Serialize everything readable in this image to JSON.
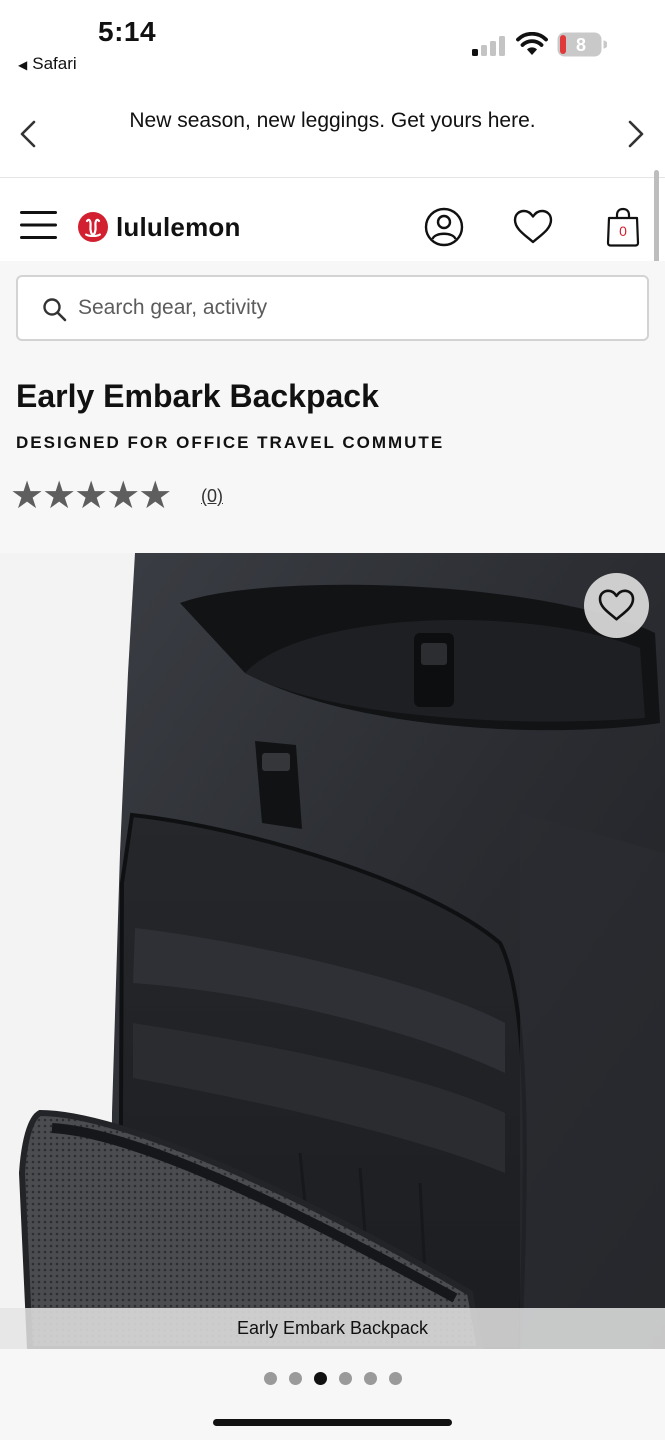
{
  "status": {
    "time": "5:14",
    "back_app": "Safari",
    "battery_level": "8"
  },
  "promo": {
    "text": "New season, new leggings. Get yours here."
  },
  "header": {
    "logo_text": "lululemon",
    "bag_count": "0"
  },
  "search": {
    "placeholder": "Search gear, activity"
  },
  "product": {
    "title": "Early Embark Backpack",
    "activities": "DESIGNED FOR OFFICE TRAVEL COMMUTE",
    "stars": "★★★★★",
    "rating_value": 0,
    "review_count": "(0)",
    "image_caption": "Early Embark Backpack"
  },
  "gallery": {
    "total_images": 6,
    "active_index": 2
  },
  "colors": {
    "brand_red": "#d22030",
    "battery_red": "#e0393a",
    "star_gray": "#5e5e5e"
  },
  "icons": [
    "back-triangle-icon",
    "signal-icon",
    "wifi-icon",
    "battery-icon",
    "chevron-left-icon",
    "chevron-right-icon",
    "hamburger-menu-icon",
    "lululemon-logo-icon",
    "account-icon",
    "heart-icon",
    "shopping-bag-icon",
    "search-icon"
  ]
}
